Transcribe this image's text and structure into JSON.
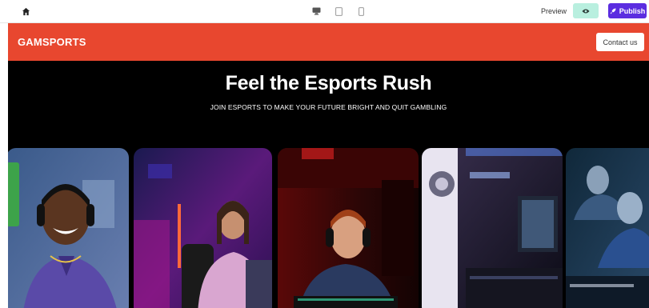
{
  "toolbar": {
    "home_icon": "home-icon",
    "devices": [
      "desktop-icon",
      "tablet-icon",
      "mobile-icon"
    ],
    "preview_label": "Preview",
    "preview_icon": "eye-icon",
    "publish_label": "Publish",
    "publish_icon": "rocket-icon",
    "accent": "#5b2de0",
    "toggle_color": "#b9efdf"
  },
  "nav": {
    "brand": "GAMSPORTS",
    "contact_label": "Contact us",
    "background": "#e8472f"
  },
  "hero": {
    "title": "Feel the Esports Rush",
    "subtitle": "JOIN ESPORTS TO MAKE YOUR FUTURE BRIGHT AND QUIT GAMBLING",
    "background": "#000000"
  },
  "gallery": {
    "images": [
      "smiling-gamer-photo",
      "gamer-pink-hoodie-photo",
      "gamer-red-light-photo",
      "gaming-room-photo",
      "lan-gamers-photo"
    ]
  }
}
